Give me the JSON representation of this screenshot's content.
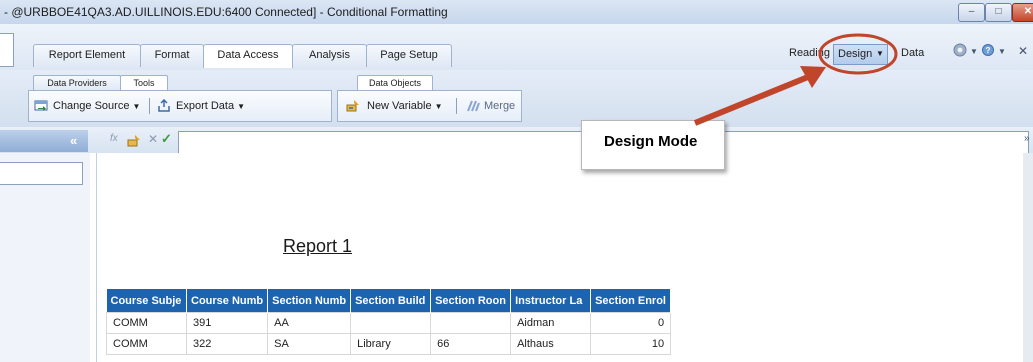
{
  "window": {
    "title": "- @URBBOE41QA3.AD.UILLINOIS.EDU:6400 Connected]  - Conditional Formatting",
    "minimize_label": "–",
    "maximize_label": "□",
    "close_label": "✕"
  },
  "ribbon_tabs": [
    {
      "label": "Report Element"
    },
    {
      "label": "Format"
    },
    {
      "label": "Data Access",
      "active": true
    },
    {
      "label": "Analysis"
    },
    {
      "label": "Page Setup"
    }
  ],
  "mode_switch": {
    "reading": "Reading",
    "design": "Design",
    "data": "Data",
    "selected": "Design"
  },
  "subtabs": {
    "data_providers": "Data Providers",
    "tools": "Tools",
    "data_objects": "Data Objects"
  },
  "toolbar": {
    "change_source": "Change Source",
    "export_data": "Export Data",
    "new_variable": "New Variable",
    "merge": "Merge"
  },
  "formula_bar": {
    "value": "",
    "fx_icon": "fx-icon",
    "cancel_icon": "cancel-icon",
    "validate_icon": "check-icon"
  },
  "report": {
    "title": "Report 1",
    "columns": [
      "Course Subje",
      "Course Numb",
      "Section Numb",
      "Section Build",
      "Section Roon",
      "Instructor La",
      "Section Enrol"
    ],
    "rows": [
      [
        "COMM",
        "391",
        "AA",
        "",
        "",
        "Aidman",
        "0"
      ],
      [
        "COMM",
        "322",
        "SA",
        "Library",
        "66",
        "Althaus",
        "10"
      ]
    ]
  },
  "callout": {
    "text": "Design Mode",
    "arrow_color": "#c0452a"
  },
  "colors": {
    "header_blue": "#1e63ad",
    "callout_red": "#c0452a"
  }
}
